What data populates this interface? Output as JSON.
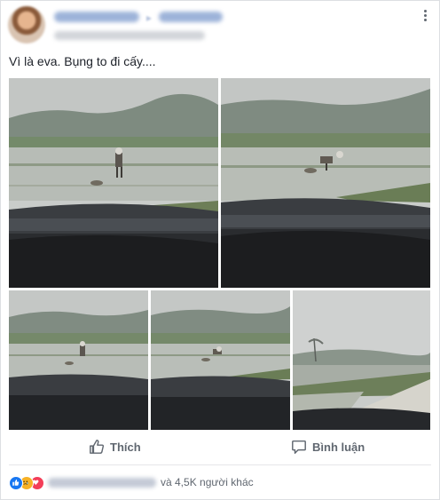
{
  "post": {
    "author_name_blurred": "",
    "caption": "Vì là eva. Bụng to đi cấy....",
    "more_icon": "more-options-icon"
  },
  "photos": [
    {
      "icon": "photo-rice-field-1"
    },
    {
      "icon": "photo-rice-field-2"
    },
    {
      "icon": "photo-rice-field-3"
    },
    {
      "icon": "photo-rice-field-4"
    },
    {
      "icon": "photo-rural-road"
    }
  ],
  "actions": {
    "like_label": "Thích",
    "comment_label": "Bình luận"
  },
  "reactions": {
    "icons": [
      "like-icon",
      "sad-icon",
      "love-icon"
    ],
    "summary_text": "và 4,5K người khác"
  },
  "colors": {
    "brand_blue": "#1877f2",
    "sad_yellow": "#f7b125",
    "love_red": "#f33e58",
    "muted_text": "#606770"
  }
}
